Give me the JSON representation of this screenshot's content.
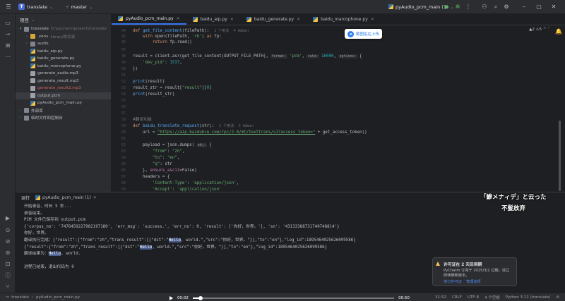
{
  "titlebar": {
    "project_badge": "T",
    "project_name": "translate",
    "branch": "master",
    "run_config": "pyAudio_pcm_main (1)"
  },
  "project_panel": {
    "title": "项目",
    "items": [
      {
        "label": "translate",
        "sub": "D:\\pycharmproject\\translate",
        "depth": 0,
        "arrow": "▾",
        "icon": "folder",
        "color": "#7f8692"
      },
      {
        "label": ".venv",
        "sub": "library根目录",
        "depth": 1,
        "arrow": "›",
        "icon": "folder",
        "color": "#d4a63e"
      },
      {
        "label": "audio",
        "sub": "",
        "depth": 1,
        "arrow": "›",
        "icon": "folder",
        "color": "#7f8692"
      },
      {
        "label": "baidu_aip.py",
        "sub": "",
        "depth": 1,
        "arrow": "",
        "icon": "py",
        "color": "#3572a5"
      },
      {
        "label": "baidu_generate.py",
        "sub": "",
        "depth": 1,
        "arrow": "",
        "icon": "py",
        "color": "#3572a5"
      },
      {
        "label": "baidu_marcophone.py",
        "sub": "",
        "depth": 1,
        "arrow": "",
        "icon": "py",
        "color": "#3572a5"
      },
      {
        "label": "generate_audio.mp3",
        "sub": "",
        "depth": 1,
        "arrow": "",
        "icon": "file",
        "color": "#9da0a8"
      },
      {
        "label": "generate_result.mp3",
        "sub": "",
        "depth": 1,
        "arrow": "",
        "icon": "file",
        "color": "#9da0a8"
      },
      {
        "label": "generate_result2.mp3",
        "sub": "",
        "depth": 1,
        "arrow": "",
        "icon": "file",
        "color": "#9da0a8",
        "text_color": "#d16464"
      },
      {
        "label": "output.pcm",
        "sub": "",
        "depth": 1,
        "arrow": "",
        "icon": "file",
        "color": "#9da0a8",
        "selected": true
      },
      {
        "label": "pyAudio_pcm_main.py",
        "sub": "",
        "depth": 1,
        "arrow": "",
        "icon": "py",
        "color": "#3572a5"
      },
      {
        "label": "外部库",
        "sub": "",
        "depth": 0,
        "arrow": "›",
        "icon": "lib",
        "color": "#7f8692"
      },
      {
        "label": "临时文件和控制台",
        "sub": "",
        "depth": 0,
        "arrow": "›",
        "icon": "scratch",
        "color": "#7f8692"
      }
    ]
  },
  "tabs": [
    {
      "label": "pyAudio_pcm_main.py",
      "active": true
    },
    {
      "label": "baidu_aip.py",
      "active": false
    },
    {
      "label": "baidu_generate.py",
      "active": false
    },
    {
      "label": "baidu_marcophone.py",
      "active": false
    }
  ],
  "editor": {
    "inspection": "▲2 ⚠5 ^ ˇ",
    "floating_button": "截图贴在上传",
    "line_numbers": [
      "44",
      "45",
      "46",
      "47",
      "48",
      "49",
      "50",
      "51",
      "52",
      "53",
      "54",
      "55",
      "56",
      "57",
      "58",
      "59",
      "60",
      "61",
      "62",
      "63",
      "64",
      "65",
      "66",
      "67",
      "68",
      "69",
      "70",
      "71",
      "72",
      "73"
    ],
    "code": {
      "l0_kw": "def ",
      "l0_fn": "get_file_content",
      "l0_rest": "(filePath):",
      "l0_hint": "1 个用法  ⚲ Admin",
      "l1_kw": "with ",
      "l1_a": "open(filePath, ",
      "l1_s": "'rb'",
      "l1_b": ") ",
      "l1_kw2": "as ",
      "l1_c": "fp:",
      "l2_kw": "return ",
      "l2_a": "fp.read()",
      "l4_a": "result = client.asr(get_file_content(OUTPUT_FILE_PATH), ",
      "l4_p1": "format:",
      "l4_s1": " 'pcm'",
      "l4_b": ", ",
      "l4_p2": "rate:",
      "l4_n": " 16000",
      "l4_c": ", ",
      "l4_p3": "options:",
      "l4_d": " {",
      "l5_s": "'dev_pid'",
      "l5_a": ": ",
      "l5_n": "1537",
      "l5_b": ",",
      "l6_a": "})",
      "l8_fn": "print",
      "l8_a": "(result)",
      "l9_a": "result_str = result[",
      "l9_s": "\"result\"",
      "l9_b": "][",
      "l9_n": "0",
      "l9_c": "]",
      "l10_fn": "print",
      "l10_a": "(result_str)",
      "l14_cm": "#翻译功能",
      "l15_kw": "def ",
      "l15_fn": "baidu_translate_request",
      "l15_a": "(str):",
      "l15_hint": "1 个用法  ⚲ Admin",
      "l16_a": "url = ",
      "l16_s": "\"https://aip.baidubce.com/rpc/2.0/mt/texttrans/v1?access_token=\"",
      "l16_b": " + get_access_token()",
      "l18_a": "payload = json.dumps( ",
      "l18_p": "obj:",
      "l18_b": " {",
      "l19_s": "\"from\"",
      "l19_a": ": ",
      "l19_s2": "\"zh\"",
      "l19_b": ",",
      "l20_s": "\"to\"",
      "l20_a": ": ",
      "l20_s2": "\"en\"",
      "l20_b": ",",
      "l21_s": "\"q\"",
      "l21_a": ": str",
      "l22_a": "}, ",
      "l22_p": "ensure_ascii",
      "l22_b": "=False)",
      "l23_a": "headers = {",
      "l24_s": "'Content-Type'",
      "l24_a": ": ",
      "l24_s2": "'application/json'",
      "l24_b": ",",
      "l25_s": "'Accept'",
      "l25_a": ": ",
      "l25_s2": "'application/json'",
      "l26_a": "}"
    }
  },
  "run_panel": {
    "tab_label": "运行",
    "config": "pyAudio_pcm_main (1)",
    "output": [
      {
        "t": "开始录音，时长 5 秒..."
      },
      {
        "t": "录音结束。"
      },
      {
        "t": "PCM 文件已保存到 output.pcm"
      },
      {
        "t": "{'corpus_no': '7476459227982197180', 'err_msg': 'success.', 'err_no': 0, 'result': ['你好，世界。'], 'sn': '431333887317407488l4'}"
      },
      {
        "t": "你好，世界。"
      },
      {
        "pre": "翻译执行完成：{\"result\":{\"from\":\"zh\",\"trans_result\":[{\"dst\":\"",
        "hl": "Hello",
        "post": ", world.\",\"src\":\"你好，世界。\"}],\"to\":\"en\"},\"log_id\":1895464025626099586}"
      },
      {
        "pre": "{\"result\":{\"from\":\"zh\",\"trans_result\":[{\"dst\":\"",
        "hl": "Hello",
        "post": ", world.\",\"src\":\"你好，世界。\"}],\"to\":\"en\"},\"log_id\":1895464025626099586}"
      },
      {
        "pre": "翻译结果为：",
        "hl": "Hello",
        "post": ", world."
      },
      {
        "t": ""
      },
      {
        "t": "进程已结束，退出代码为 0"
      }
    ]
  },
  "subtitles": {
    "line1": "「鰺メナィデ」と云った",
    "line2": "不髪放弃"
  },
  "notification": {
    "title": "许可证在 2 天后到期",
    "body": "PyCharm 订阅于 2025/3/2 过期。请立即续期新版本。",
    "link1": "续订许可证",
    "link2": "管理选项"
  },
  "status": {
    "breadcrumb1": "translate",
    "breadcrumb2": "pyAudio_pcm_main.py",
    "position": "31:52",
    "line_sep": "CRLF",
    "encoding": "UTF-8",
    "indent": "4 个空格",
    "interpreter": "Python 3.11 (translate)"
  },
  "player": {
    "current": "00:02",
    "total": "00:50",
    "progress": 0.04
  }
}
